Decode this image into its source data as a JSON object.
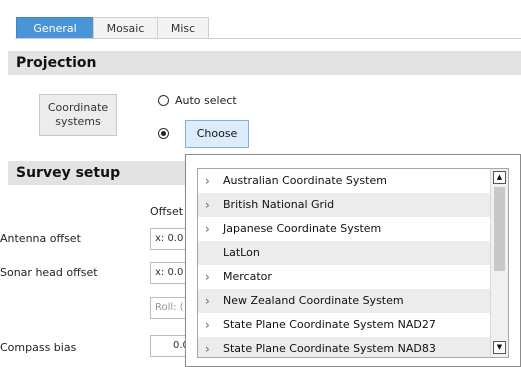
{
  "tabs": [
    {
      "label": "General",
      "active": true
    },
    {
      "label": "Mosaic",
      "active": false
    },
    {
      "label": "Misc",
      "active": false
    }
  ],
  "projection": {
    "title": "Projection",
    "coord_button_label": "Coordinate\nsystems",
    "auto_select_label": "Auto select",
    "choose_label": "Choose",
    "selected_option": "choose"
  },
  "survey": {
    "title": "Survey setup",
    "offset_col_label": "Offset",
    "antenna_label": "Antenna offset",
    "antenna_x": "x: 0.0",
    "sonar_label": "Sonar head offset",
    "sonar_x": "x: 0.0",
    "roll_field": "Roll: (",
    "compass_label": "Compass bias",
    "compass_value": "0.0"
  },
  "dropdown": {
    "items": [
      {
        "label": "Australian Coordinate System",
        "expandable": true
      },
      {
        "label": "British National Grid",
        "expandable": true
      },
      {
        "label": "Japanese Coordinate System",
        "expandable": true
      },
      {
        "label": "LatLon",
        "expandable": false
      },
      {
        "label": "Mercator",
        "expandable": true
      },
      {
        "label": "New Zealand Coordinate System",
        "expandable": true
      },
      {
        "label": "State Plane Coordinate System NAD27",
        "expandable": true
      },
      {
        "label": "State Plane Coordinate System NAD83",
        "expandable": true
      }
    ],
    "scroll_up": "▲",
    "scroll_down": "▼"
  },
  "colors": {
    "accent": "#4a95d8",
    "section_bg": "#e3e3e3",
    "choose_bg": "#dcecfb"
  }
}
